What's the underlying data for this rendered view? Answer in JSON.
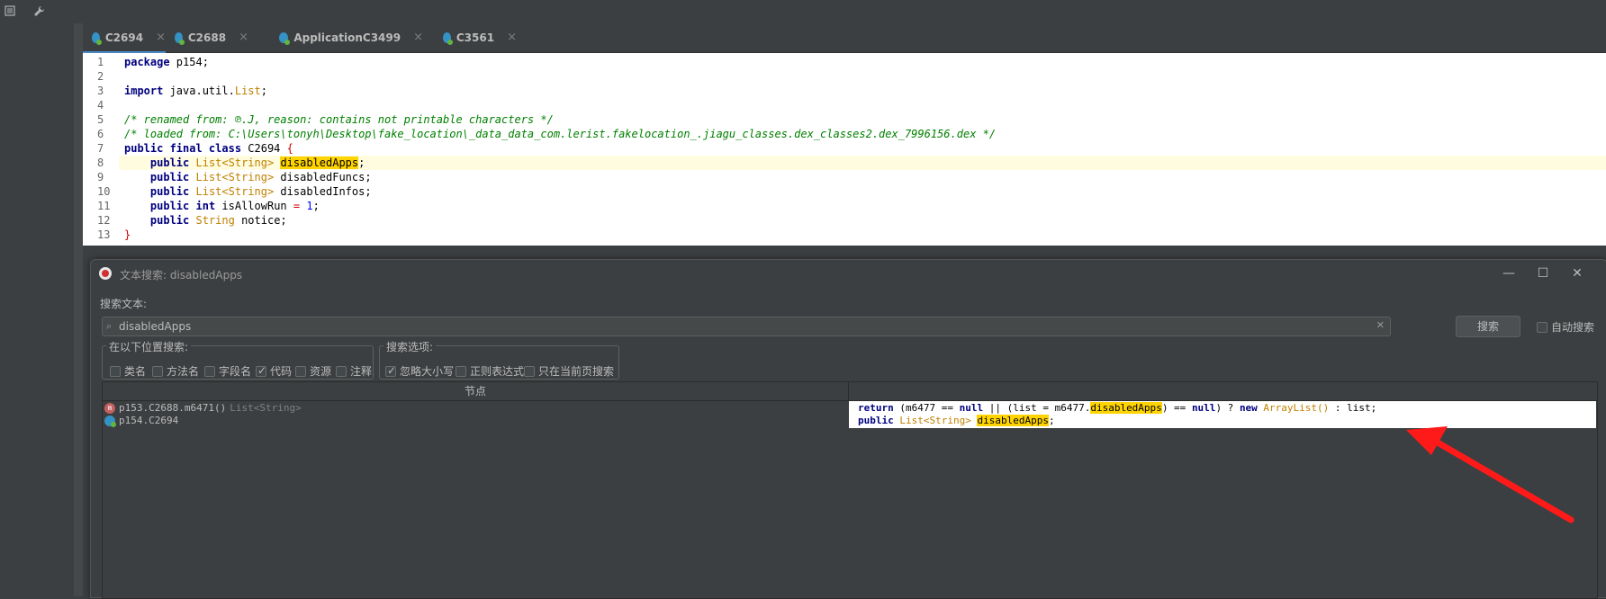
{
  "tabs": [
    {
      "label": "C2694",
      "active": true
    },
    {
      "label": "C2688",
      "active": false
    },
    {
      "label": "ApplicationC3499",
      "active": false
    },
    {
      "label": "C3561",
      "active": false
    }
  ],
  "editor": {
    "line_numbers": [
      "1",
      "2",
      "3",
      "4",
      "5",
      "6",
      "7",
      "8",
      "9",
      "10",
      "11",
      "12",
      "13"
    ],
    "highlighted_line": "8",
    "code": {
      "l1": {
        "kw": "package",
        "rest": " p154;"
      },
      "l3": {
        "kw": "import",
        "pre": " java.util.",
        "type": "List",
        "post": ";"
      },
      "l5": "/* renamed from: ℗.J, reason: contains not printable characters */",
      "l6": "/* loaded from: C:\\Users\\tonyh\\Desktop\\fake_location\\_data_data_com.lerist.fakelocation_.jiagu_classes.dex_classes2.dex_7996156.dex */",
      "l7": {
        "kw": "public final class",
        "name": " C2694 ",
        "brace": "{"
      },
      "l8": {
        "kw": "public",
        "type": "List<String>",
        "match": "disabledApps",
        "post": ";"
      },
      "l9": {
        "kw": "public",
        "type": "List<String>",
        "rest": " disabledFuncs;"
      },
      "l10": {
        "kw": "public",
        "type": "List<String>",
        "rest": " disabledInfos;"
      },
      "l11": {
        "kw": "public",
        "kw2": "int",
        "rest": " isAllowRun ",
        "op": "=",
        "num": " 1",
        "post": ";"
      },
      "l12": {
        "kw": "public",
        "type": "String",
        "rest": " notice;"
      },
      "l13": "}"
    }
  },
  "dialog": {
    "title": "文本搜索: disabledApps",
    "search_label": "搜索文本:",
    "search_value": "disabledApps",
    "search_button": "搜索",
    "auto_search": "自动搜索",
    "location_group": {
      "title": "在以下位置搜索:",
      "options": [
        {
          "label": "类名",
          "checked": false
        },
        {
          "label": "方法名",
          "checked": false
        },
        {
          "label": "字段名",
          "checked": false
        },
        {
          "label": "代码",
          "checked": true
        },
        {
          "label": "资源",
          "checked": false
        },
        {
          "label": "注释",
          "checked": false
        }
      ]
    },
    "options_group": {
      "title": "搜索选项:",
      "options": [
        {
          "label": "忽略大小写",
          "checked": true
        },
        {
          "label": "正则表达式",
          "checked": false
        },
        {
          "label": "只在当前页搜索",
          "checked": false
        }
      ]
    },
    "results": {
      "column_node": "节点",
      "rows": [
        {
          "node": "p153.C2688.m6471()",
          "type": "List<String>",
          "icon": "method-icon"
        },
        {
          "node": "p154.C2694",
          "type": "",
          "icon": "class-icon"
        }
      ],
      "code_lines": {
        "r1": {
          "kw": "return",
          "a": " (m6477 == ",
          "kw_null": "null",
          "b": " || (list = m6477.",
          "match": "disabledApps",
          "c": ") == ",
          "kw_null2": "null",
          "d": ") ? ",
          "kw_new": "new",
          "type": " ArrayList()",
          "e": " : list;"
        },
        "r2": {
          "kw": "public",
          "type": " List<String> ",
          "match": "disabledApps",
          "post": ";"
        }
      }
    }
  },
  "annotation_color": "#ff1a1a"
}
